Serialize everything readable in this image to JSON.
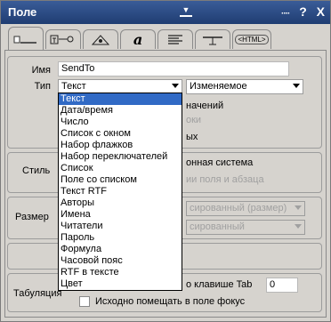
{
  "window": {
    "title": "Поле",
    "controls": [
      "····",
      "?",
      "X"
    ]
  },
  "tabs": [
    {
      "name": "tab-basics",
      "icon": "field-info-icon",
      "active": true
    },
    {
      "name": "tab-control",
      "icon": "control-icon",
      "active": false
    },
    {
      "name": "tab-advanced",
      "icon": "advanced-icon",
      "active": false
    },
    {
      "name": "tab-font",
      "icon": "font-icon",
      "active": false,
      "glyph": "a"
    },
    {
      "name": "tab-paragraph",
      "icon": "paragraph-icon",
      "active": false
    },
    {
      "name": "tab-hide",
      "icon": "hide-when-icon",
      "active": false
    },
    {
      "name": "tab-html",
      "icon": "html-icon",
      "active": false,
      "glyph": "<HTML>"
    }
  ],
  "form": {
    "name_label": "Имя",
    "name_value": "SendTo",
    "type_label": "Тип",
    "type_value": "Текст",
    "mode_value": "Изменяемое",
    "partial_1": "начений",
    "partial_2": "оки",
    "partial_3": "ых",
    "style_label": "Стиль",
    "style_partial": "онная система",
    "style_partial_2": "ии поля и абзаца",
    "size_label": "Размер",
    "size_combo_1": "сированный (размер)",
    "size_combo_2": "сированный",
    "tab_label": "Табуляция",
    "tab_partial": "о клавише Tab",
    "tab_value": "0",
    "focus_label": "Исходно помещать в поле фокус"
  },
  "dropdown": {
    "items": [
      "Текст",
      "Дата/время",
      "Число",
      "Список с окном",
      "Набор флажков",
      "Набор переключателей",
      "Список",
      "Поле со списком",
      "Текст RTF",
      "Авторы",
      "Имена",
      "Читатели",
      "Пароль",
      "Формула",
      "Часовой пояс",
      "RTF в тексте",
      "Цвет"
    ],
    "selected_index": 0
  }
}
